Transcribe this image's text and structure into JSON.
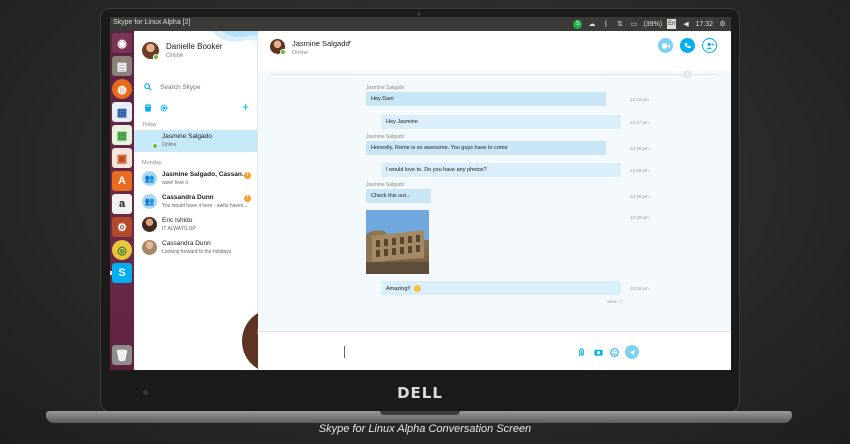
{
  "caption": "Skype for Linux Alpha Conversation Screen",
  "brand": "DELL",
  "topbar": {
    "title": "Skype for Linux Alpha [2]",
    "battery": "(39%)",
    "clock": "17:32",
    "keyboard": "En"
  },
  "profile": {
    "name": "Danielle Booker",
    "status": "Online"
  },
  "search": {
    "placeholder": "Search Skype"
  },
  "sections": {
    "today": "Today",
    "monday": "Monday"
  },
  "conversations": [
    {
      "name": "Jasmine Salgado",
      "message": "Online",
      "selected": true,
      "unread": ""
    },
    {
      "name": "Jasmine Salgado, Cassan...",
      "message": "wow! love it",
      "selected": false,
      "unread": "1"
    },
    {
      "name": "Cassandra Dunn",
      "message": "You would have it here · awful haves...",
      "selected": false,
      "unread": "1"
    },
    {
      "name": "Eric Ishido",
      "message": "IT ALWAYS UP",
      "selected": false,
      "unread": ""
    },
    {
      "name": "Cassandra Dunn",
      "message": "Looking forward to the holidays",
      "selected": false,
      "unread": ""
    }
  ],
  "chat": {
    "contact_name": "Jasmine Salgado",
    "contact_status": "Online",
    "messages": [
      {
        "sender": "Jasmine Salgado",
        "text": "Hey Dani",
        "time": "12:23 pm"
      },
      {
        "sender": "",
        "text": "Hey Jasmine",
        "time": "12:27 pm"
      },
      {
        "sender": "Jasmine Salgado",
        "text": "Honestly, Rome is so awesome. You guys have to come",
        "time": "12:28 pm"
      },
      {
        "sender": "",
        "text": "I would love to. Do you have any photos?",
        "time": "12:28 pm"
      },
      {
        "sender": "Jasmine Salgado",
        "text": "Check this out...",
        "time": "12:28 pm"
      },
      {
        "sender": "",
        "text": "",
        "time": "12:28 pm"
      },
      {
        "sender": "",
        "text": "Amazing!!",
        "time": "12:29 pm"
      }
    ],
    "seen": "Seen",
    "compose_placeholder": ""
  },
  "colors": {
    "accent": "#00aff0",
    "selected": "#c6e9fa",
    "online": "#5fc133",
    "launcher": "#5e2240"
  }
}
